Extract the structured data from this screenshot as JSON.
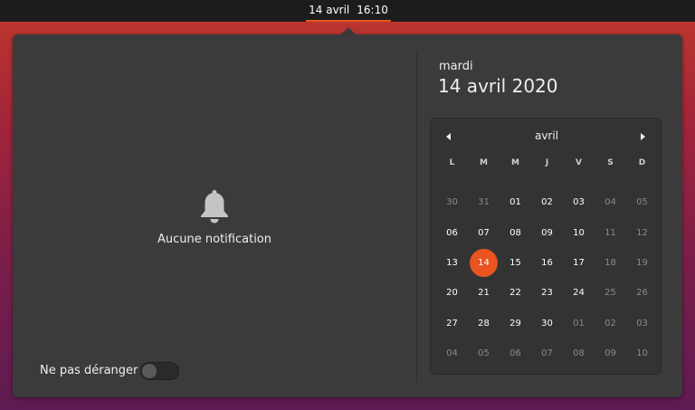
{
  "topbar": {
    "date": "14 avril",
    "time": "16:10"
  },
  "notifications": {
    "empty_message": "Aucune notification",
    "dnd_label": "Ne pas déranger",
    "dnd_enabled": false
  },
  "calendar": {
    "weekday_name": "mardi",
    "full_date": "14 avril 2020",
    "month": "avril",
    "weekday_headers": [
      "L",
      "M",
      "M",
      "J",
      "V",
      "S",
      "D"
    ],
    "weeks": [
      [
        "30",
        "31",
        "01",
        "02",
        "03",
        "04",
        "05"
      ],
      [
        "06",
        "07",
        "08",
        "09",
        "10",
        "11",
        "12"
      ],
      [
        "13",
        "14",
        "15",
        "16",
        "17",
        "18",
        "19"
      ],
      [
        "20",
        "21",
        "22",
        "23",
        "24",
        "25",
        "26"
      ],
      [
        "27",
        "28",
        "29",
        "30",
        "01",
        "02",
        "03"
      ],
      [
        "04",
        "05",
        "06",
        "07",
        "08",
        "09",
        "10"
      ]
    ],
    "today": "14",
    "accent_color": "#e95420"
  },
  "icons": {
    "bell": "bell-icon",
    "prev": "chevron-left-icon",
    "next": "chevron-right-icon"
  }
}
